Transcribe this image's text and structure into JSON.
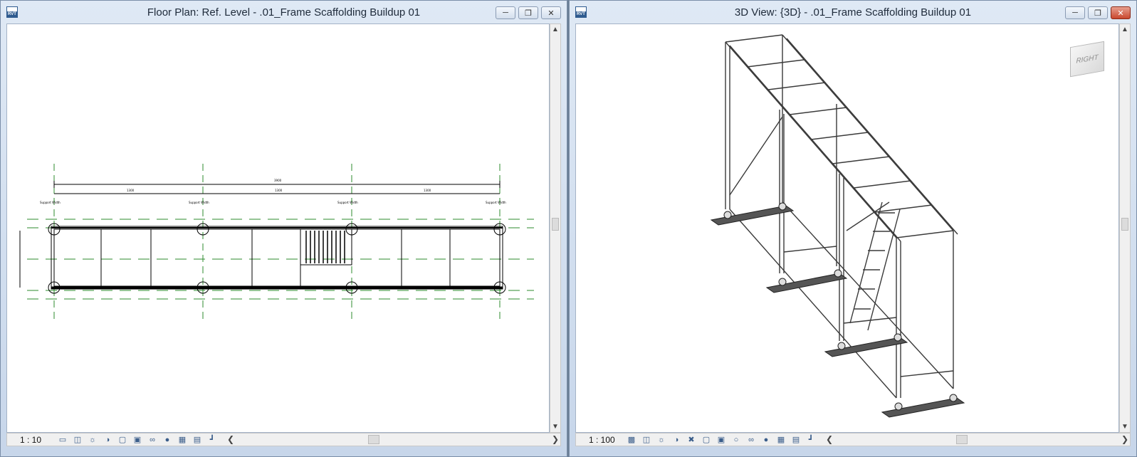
{
  "floor_plan_window": {
    "title": "Floor Plan: Ref. Level - .01_Frame Scaffolding Buildup 01",
    "app_icon_text": "RVT",
    "scale": "1 : 10",
    "caption_buttons": [
      "minimize",
      "restore",
      "close"
    ],
    "view_controls": [
      "detail-level-icon",
      "visual-style-icon",
      "sun-path-icon",
      "shadows-icon",
      "crop-view-icon",
      "show-crop-icon",
      "temporary-hide-icon",
      "reveal-hidden-icon",
      "analysis-icon",
      "highlight-displacement-icon",
      "constraints-icon"
    ]
  },
  "view_3d_window": {
    "title": "3D View: {3D} - .01_Frame Scaffolding Buildup 01",
    "app_icon_text": "RVT",
    "scale": "1 : 100",
    "viewcube_label": "RIGHT",
    "caption_buttons": [
      "minimize",
      "restore",
      "close"
    ],
    "view_controls": [
      "detail-level-icon",
      "visual-style-icon",
      "sun-path-icon",
      "shadows-icon",
      "render-icon",
      "crop-view-icon",
      "show-crop-icon",
      "lock-view-icon",
      "temporary-hide-icon",
      "reveal-hidden-icon",
      "analysis-icon",
      "highlight-displacement-icon",
      "constraints-icon"
    ]
  },
  "plan_labels": {
    "support_label": "Support Width",
    "overall_dim": "3900",
    "bay_dim": "1300"
  },
  "colors": {
    "grid_green": "#2e8b2e",
    "window_border": "#7a8ea8",
    "close_red": "#c9472e"
  }
}
